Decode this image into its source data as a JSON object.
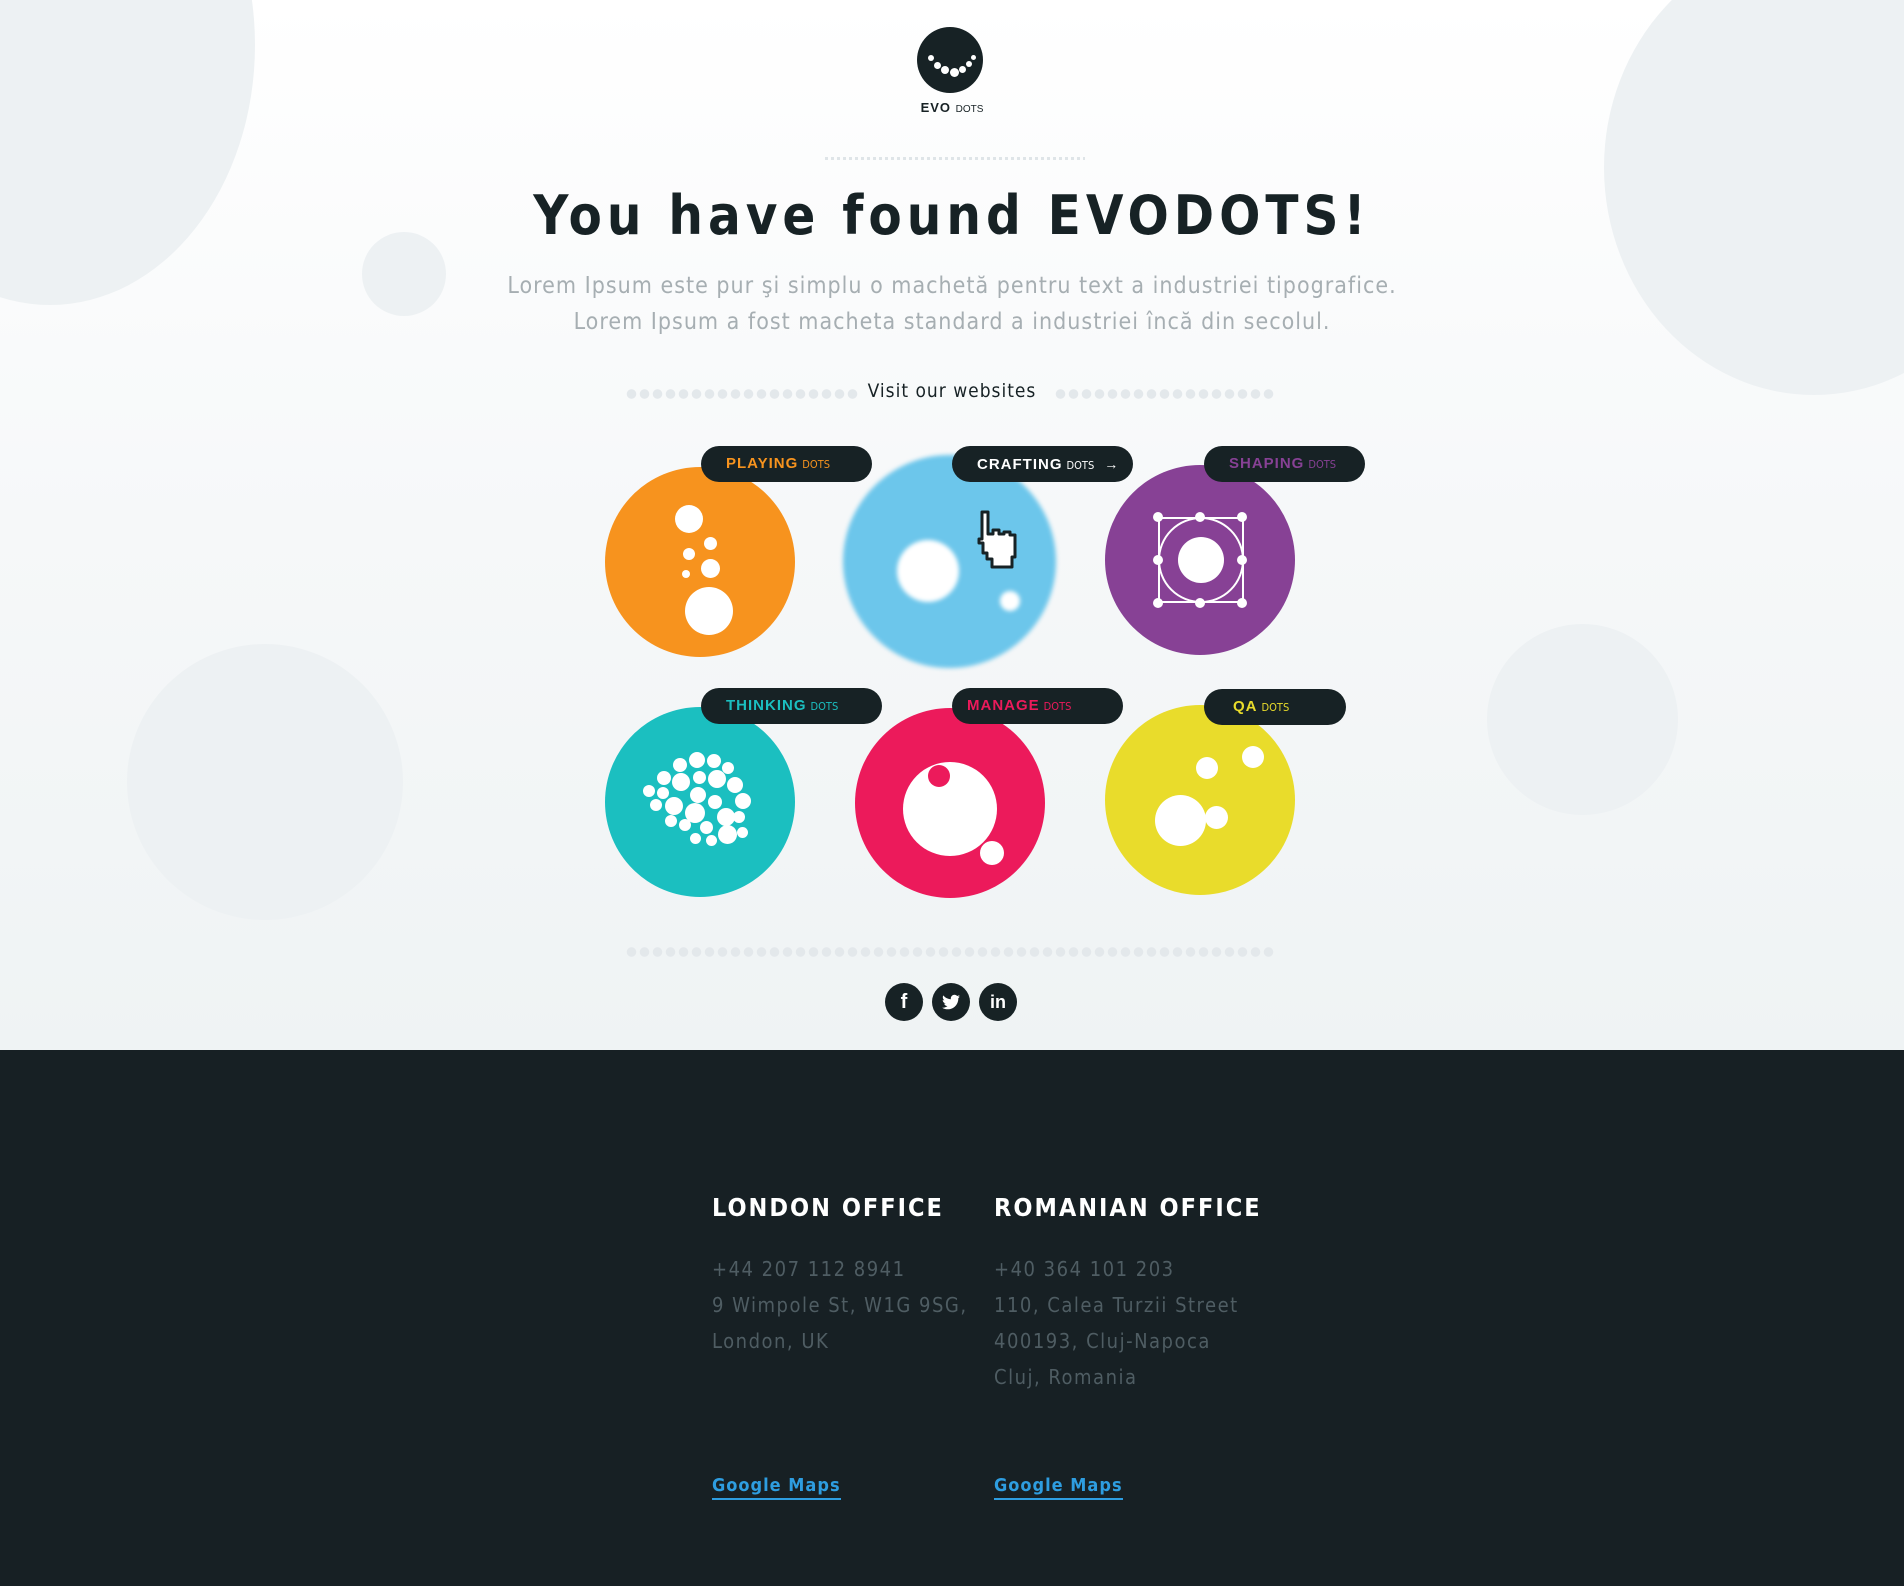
{
  "brand": {
    "logo_main": "EVO",
    "logo_suffix": "DOTS"
  },
  "hero": {
    "title": "You have found EVODOTS!",
    "subtitle_line1": "Lorem Ipsum este pur şi simplu o machetă pentru text a industriei tipografice.",
    "subtitle_line2": "Lorem Ipsum a fost macheta standard a industriei încă din secolul.",
    "visit_label": "Visit our websites"
  },
  "sites": [
    {
      "name": "PLAYING",
      "suffix": "DOTS",
      "color": "#f7931e",
      "icon": "bubbles-icon"
    },
    {
      "name": "CRAFTING",
      "suffix": "DOTS",
      "color": "#6cc6eb",
      "icon": "cursor-hand-icon",
      "arrow": "→"
    },
    {
      "name": "SHAPING",
      "suffix": "DOTS",
      "color": "#874195",
      "icon": "vector-shape-icon"
    },
    {
      "name": "THINKING",
      "suffix": "DOTS",
      "color": "#1bbfc0",
      "icon": "brain-dots-icon"
    },
    {
      "name": "MANAGE",
      "suffix": "DOTS",
      "color": "#ec1a5b",
      "icon": "eye-dot-icon"
    },
    {
      "name": "QA",
      "suffix": "DOTS",
      "color": "#e9dc2b",
      "icon": "qa-dots-icon"
    }
  ],
  "social": [
    {
      "name": "facebook",
      "glyph": "f"
    },
    {
      "name": "twitter",
      "glyph": "t"
    },
    {
      "name": "linkedin",
      "glyph": "in"
    }
  ],
  "footer": {
    "london": {
      "title": "LONDON OFFICE",
      "phone": "+44 207 112 8941",
      "address1": "9 Wimpole St, W1G 9SG,",
      "address2": "London, UK",
      "maps": "Google Maps"
    },
    "romania": {
      "title": "ROMANIAN OFFICE",
      "phone": "+40 364 101 203",
      "address1": "110, Calea Turzii Street",
      "address2": "400193, Cluj-Napoca",
      "address3": "Cluj, Romania",
      "maps": "Google Maps"
    }
  }
}
